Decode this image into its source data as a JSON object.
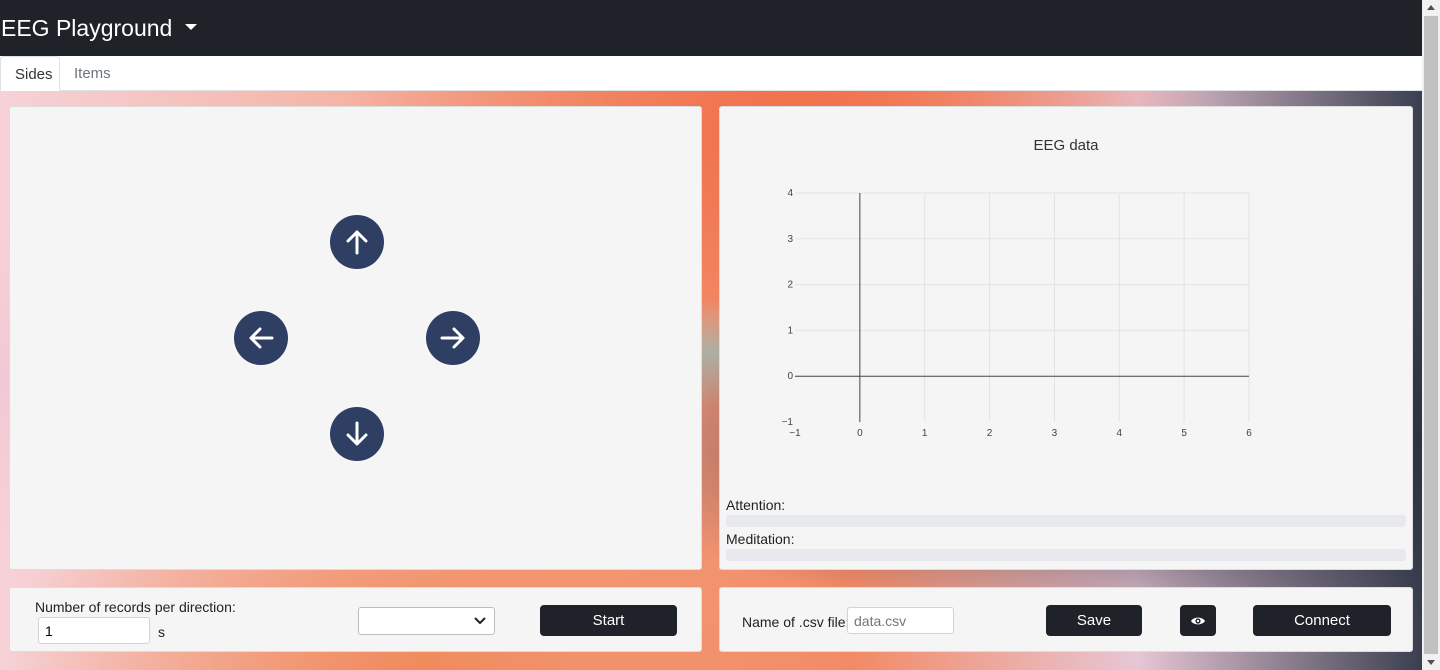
{
  "navbar": {
    "brand": "EEG Playground",
    "brand_caret_icon": "caret-down-icon"
  },
  "tabs": [
    {
      "label": "Sides",
      "active": true
    },
    {
      "label": "Items",
      "active": false
    }
  ],
  "controls": {
    "up_icon": "arrow-up-icon",
    "left_icon": "arrow-left-icon",
    "right_icon": "arrow-right-icon",
    "down_icon": "arrow-down-icon"
  },
  "chart": {
    "title": "EEG data",
    "attention_label": "Attention:",
    "meditation_label": "Meditation:",
    "attention_value": 0,
    "meditation_value": 0
  },
  "chart_data": {
    "type": "line",
    "title": "EEG data",
    "series": [],
    "xlim": [
      -1,
      6
    ],
    "ylim": [
      -1,
      4
    ],
    "xticks": [
      "−1",
      "0",
      "1",
      "2",
      "3",
      "4",
      "5",
      "6"
    ],
    "yticks": [
      "−1",
      "0",
      "1",
      "2",
      "3",
      "4"
    ],
    "grid": true
  },
  "recording": {
    "label": "Number of records per direction:",
    "value": "1",
    "unit": "s",
    "select_value": "",
    "start_label": "Start"
  },
  "file": {
    "label": "Name of .csv file:",
    "placeholder": "data.csv",
    "save_label": "Save",
    "view_icon": "eye-icon",
    "connect_label": "Connect"
  },
  "colors": {
    "navbar": "#1f2229",
    "arrow_button": "#2e3f63",
    "card": "#f5f5f5"
  }
}
